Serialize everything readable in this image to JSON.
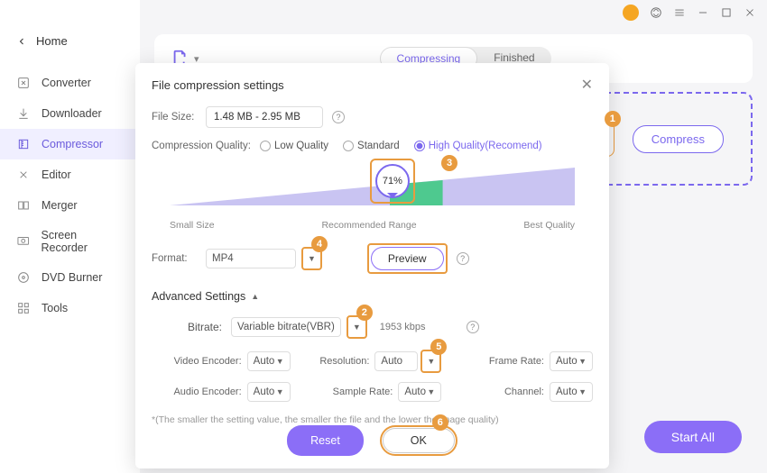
{
  "titlebar": {},
  "sidebar": {
    "home": "Home",
    "items": [
      {
        "label": "Converter"
      },
      {
        "label": "Downloader"
      },
      {
        "label": "Compressor"
      },
      {
        "label": "Editor"
      },
      {
        "label": "Merger"
      },
      {
        "label": "Screen Recorder"
      },
      {
        "label": "DVD Burner"
      },
      {
        "label": "Tools"
      }
    ]
  },
  "main": {
    "tabs": {
      "compressing": "Compressing",
      "finished": "Finished"
    },
    "compress_btn": "Compress",
    "start_all": "Start All"
  },
  "modal": {
    "title": "File compression settings",
    "file_size_label": "File Size:",
    "file_size_value": "1.48 MB - 2.95 MB",
    "quality_label": "Compression Quality:",
    "quality_options": {
      "low": "Low Quality",
      "standard": "Standard",
      "high": "High Quality(Recomend)"
    },
    "slider": {
      "value": "71%",
      "left": "Small Size",
      "mid": "Recommended Range",
      "right": "Best Quality"
    },
    "format_label": "Format:",
    "format_value": "MP4",
    "preview_btn": "Preview",
    "adv_title": "Advanced Settings",
    "bitrate_label": "Bitrate:",
    "bitrate_value": "Variable bitrate(VBR)",
    "bitrate_placeholder": "1953 kbps",
    "video_enc_label": "Video Encoder:",
    "video_enc_value": "Auto",
    "resolution_label": "Resolution:",
    "resolution_value": "Auto",
    "frame_rate_label": "Frame Rate:",
    "frame_rate_value": "Auto",
    "audio_enc_label": "Audio Encoder:",
    "audio_enc_value": "Auto",
    "sample_rate_label": "Sample Rate:",
    "sample_rate_value": "Auto",
    "channel_label": "Channel:",
    "channel_value": "Auto",
    "footnote": "*(The smaller the setting value, the smaller the file and the lower the image quality)",
    "reset_btn": "Reset",
    "ok_btn": "OK"
  },
  "callouts": {
    "1": "1",
    "2": "2",
    "3": "3",
    "4": "4",
    "5": "5",
    "6": "6"
  }
}
